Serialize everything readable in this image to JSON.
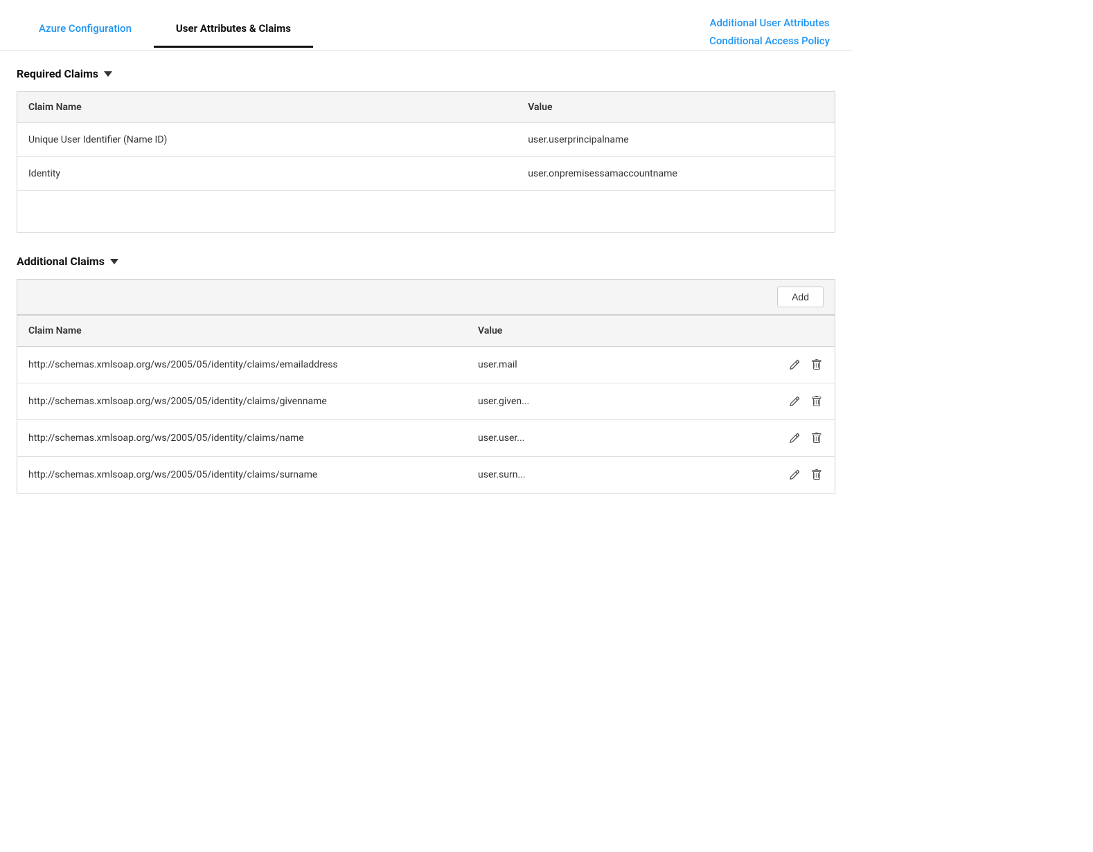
{
  "nav": {
    "azure_config_label": "Azure Configuration",
    "user_attributes_label": "User Attributes & Claims",
    "additional_user_attr_label": "Additional User Attributes",
    "conditional_access_label": "Conditional Access Policy"
  },
  "required_claims": {
    "section_title": "Required Claims",
    "col_name": "Claim Name",
    "col_value": "Value",
    "rows": [
      {
        "name": "Unique User Identifier (Name ID)",
        "value": "user.userprincipalname"
      },
      {
        "name": "Identity",
        "value": "user.onpremisessamaccountname"
      }
    ]
  },
  "additional_claims": {
    "section_title": "Additional Claims",
    "add_button_label": "Add",
    "col_name": "Claim Name",
    "col_value": "Value",
    "rows": [
      {
        "name": "http://schemas.xmlsoap.org/ws/2005/05/identity/claims/emailaddress",
        "value": "user.mail"
      },
      {
        "name": "http://schemas.xmlsoap.org/ws/2005/05/identity/claims/givenname",
        "value": "user.given..."
      },
      {
        "name": "http://schemas.xmlsoap.org/ws/2005/05/identity/claims/name",
        "value": "user.user..."
      },
      {
        "name": "http://schemas.xmlsoap.org/ws/2005/05/identity/claims/surname",
        "value": "user.surn..."
      }
    ]
  }
}
